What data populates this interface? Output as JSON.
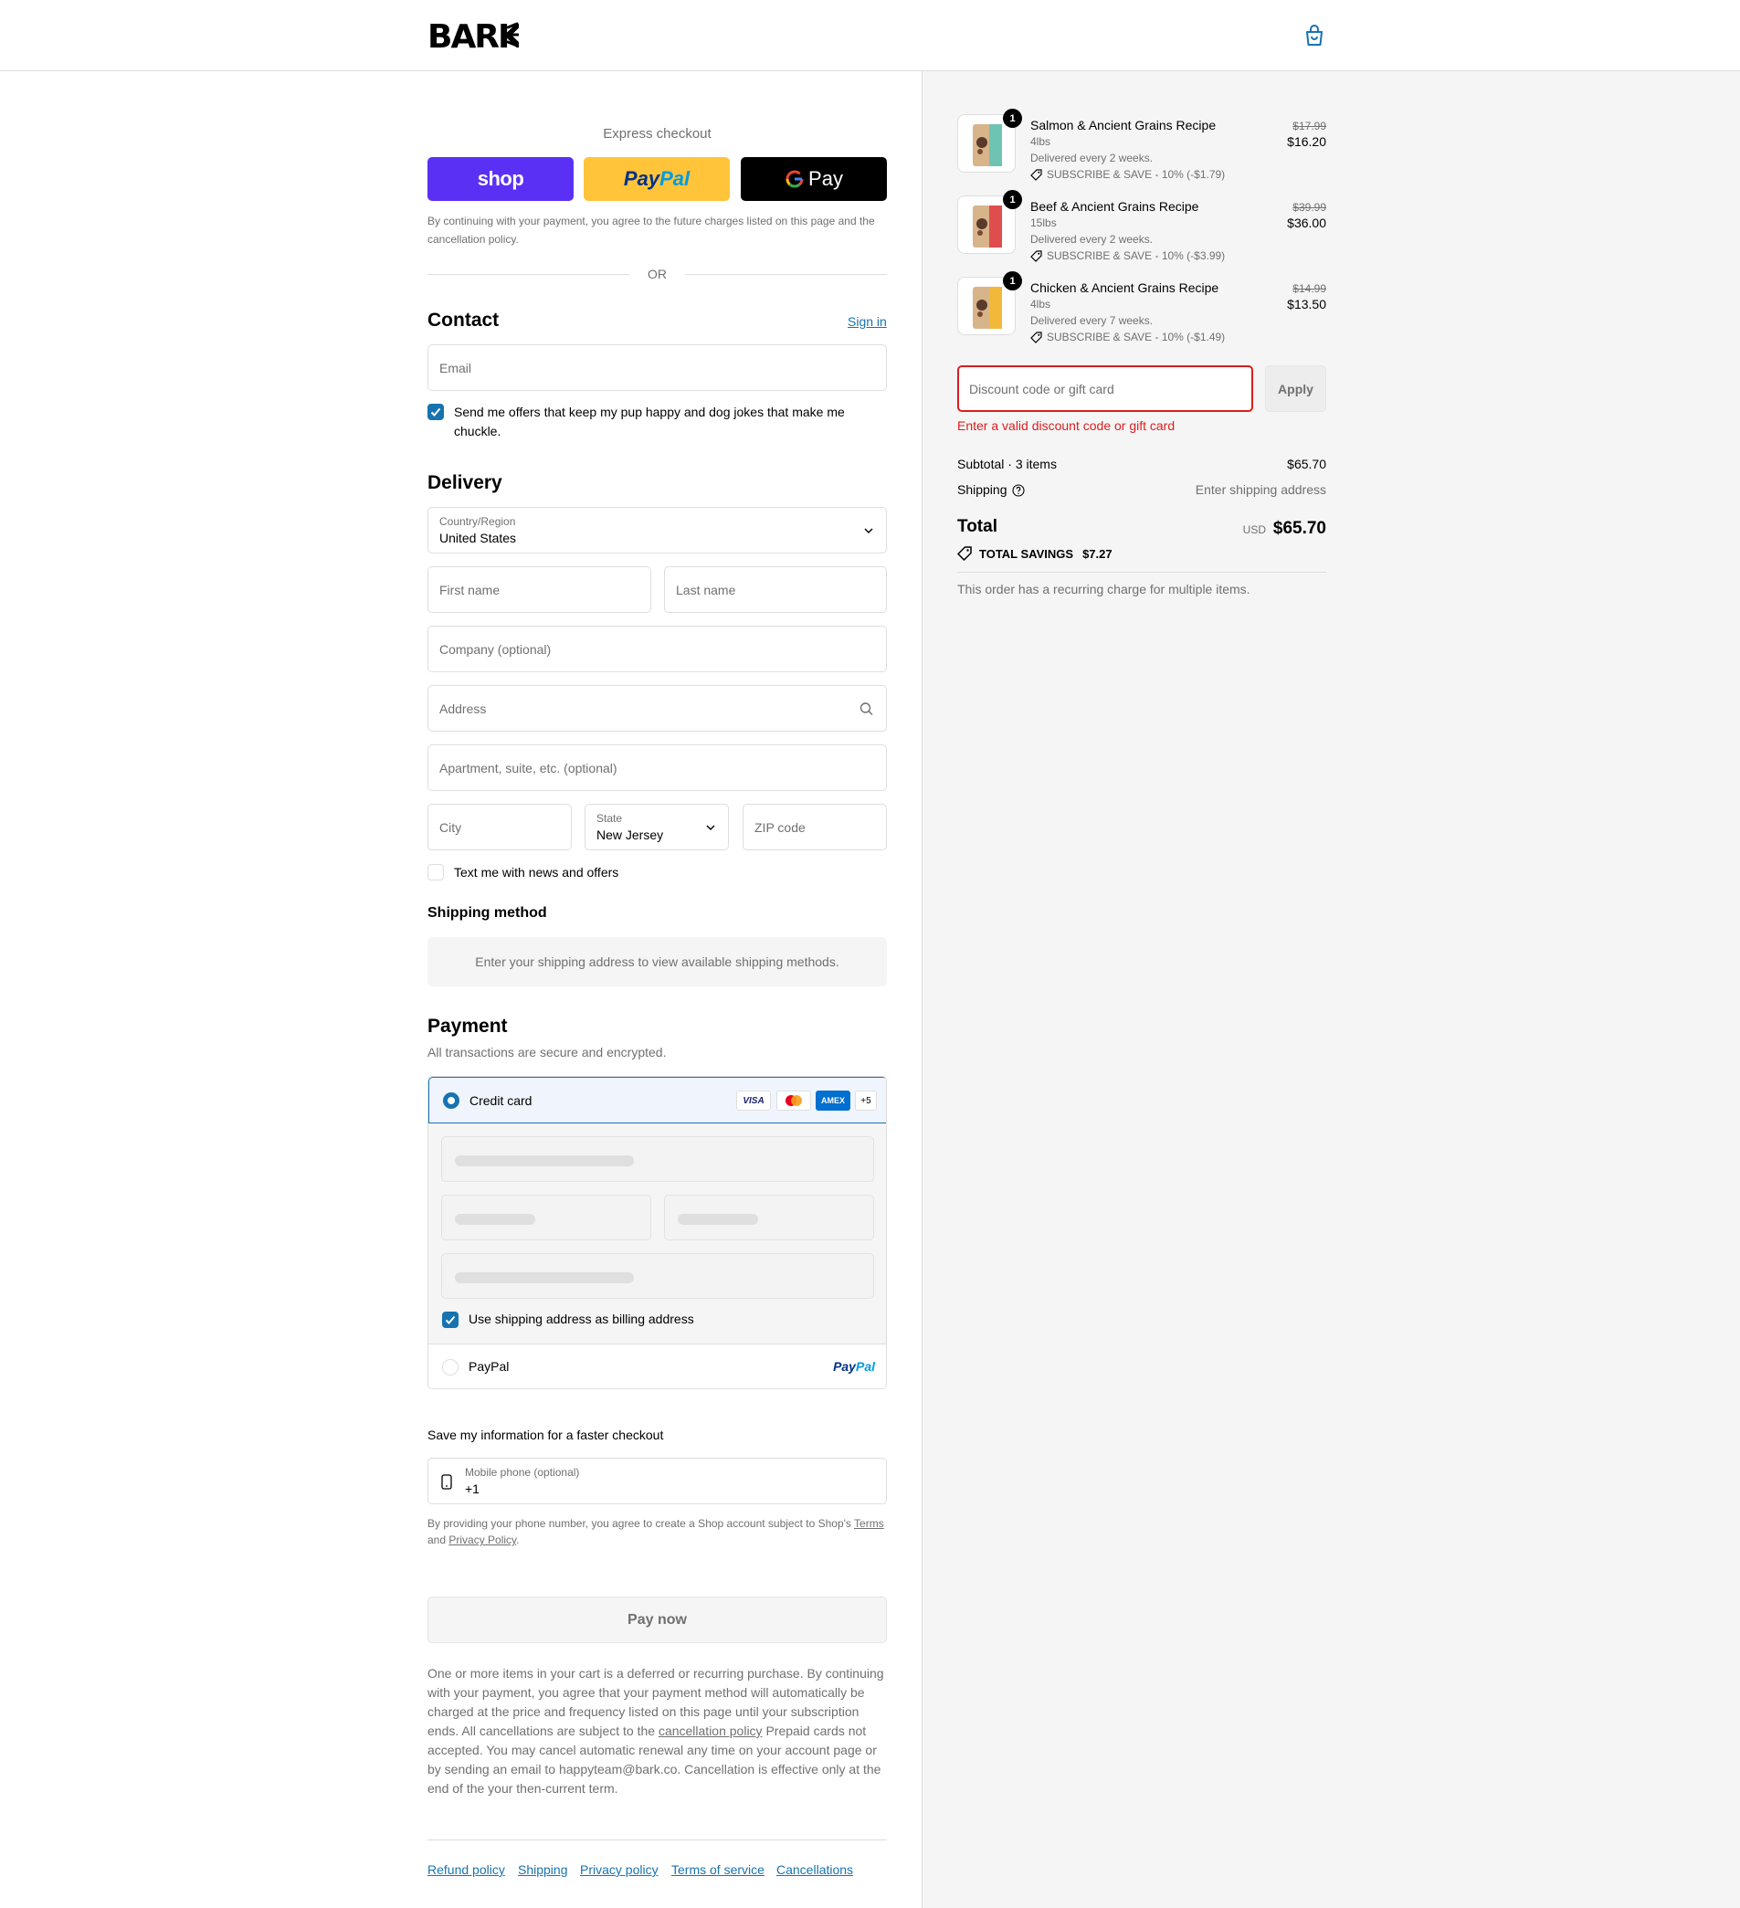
{
  "brand": {
    "logo_text": "BARK",
    "accent": "#1773b0",
    "error": "#dd1d1d"
  },
  "express": {
    "label": "Express checkout",
    "shop_label": "shop",
    "paypal_label_a": "Pay",
    "paypal_label_b": "Pal",
    "gpay_label": "Pay",
    "note": "By continuing with your payment, you agree to the future charges listed on this page and the cancellation policy.",
    "or": "OR"
  },
  "contact": {
    "title": "Contact",
    "sign_in": "Sign in",
    "email_placeholder": "Email",
    "offers_label": "Send me offers that keep my pup happy and dog jokes that make me chuckle.",
    "offers_checked": true
  },
  "delivery": {
    "title": "Delivery",
    "country_label": "Country/Region",
    "country_value": "United States",
    "first_name_placeholder": "First name",
    "last_name_placeholder": "Last name",
    "company_placeholder": "Company (optional)",
    "address_placeholder": "Address",
    "apartment_placeholder": "Apartment, suite, etc. (optional)",
    "city_placeholder": "City",
    "state_label": "State",
    "state_value": "New Jersey",
    "zip_placeholder": "ZIP code",
    "text_me_label": "Text me with news and offers",
    "text_me_checked": false
  },
  "shipping_method": {
    "title": "Shipping method",
    "message": "Enter your shipping address to view available shipping methods."
  },
  "payment": {
    "title": "Payment",
    "subtitle": "All transactions are secure and encrypted.",
    "credit_card_label": "Credit card",
    "card_brands": [
      "VISA",
      "mastercard",
      "AMEX",
      "+5"
    ],
    "billing_label": "Use shipping address as billing address",
    "billing_checked": true,
    "paypal_label": "PayPal",
    "paypal_logo_a": "Pay",
    "paypal_logo_b": "Pal"
  },
  "save_info": {
    "title": "Save my information for a faster checkout",
    "phone_label": "Mobile phone (optional)",
    "phone_value": "+1",
    "note_a": "By providing your phone number, you agree to create a Shop account subject to Shop's ",
    "terms": "Terms",
    "note_b": " and ",
    "privacy": "Privacy Policy",
    "note_c": "."
  },
  "pay_now_label": "Pay now",
  "legal": {
    "text_a": "One or more items in your cart is a deferred or recurring purchase. By continuing with your payment, you agree that your payment method will automatically be charged at the price and frequency listed on this page until your subscription ends. All cancellations are subject to the ",
    "link": "cancellation policy",
    "text_b": " Prepaid cards not accepted. You may cancel automatic renewal any time on your account page or by sending an email to happyteam@bark.co. Cancellation is effective only at the end of the your then-current term."
  },
  "footer_links": [
    "Refund policy",
    "Shipping",
    "Privacy policy",
    "Terms of service",
    "Cancellations"
  ],
  "cart": {
    "items": [
      {
        "qty": "1",
        "name": "Salmon & Ancient Grains Recipe",
        "size": "4lbs",
        "frequency": "Delivered every 2 weeks.",
        "discount": "SUBSCRIBE & SAVE - 10% (-$1.79)",
        "old_price": "$17.99",
        "price": "$16.20",
        "color": "#6fc3b3"
      },
      {
        "qty": "1",
        "name": "Beef & Ancient Grains Recipe",
        "size": "15lbs",
        "frequency": "Delivered every 2 weeks.",
        "discount": "SUBSCRIBE & SAVE - 10% (-$3.99)",
        "old_price": "$39.99",
        "price": "$36.00",
        "color": "#e04d4d"
      },
      {
        "qty": "1",
        "name": "Chicken & Ancient Grains Recipe",
        "size": "4lbs",
        "frequency": "Delivered every 7 weeks.",
        "discount": "SUBSCRIBE & SAVE - 10% (-$1.49)",
        "old_price": "$14.99",
        "price": "$13.50",
        "color": "#f2b83a"
      }
    ],
    "discount_placeholder": "Discount code or gift card",
    "apply_label": "Apply",
    "discount_error": "Enter a valid discount code or gift card",
    "subtotal_label": "Subtotal · 3 items",
    "subtotal_value": "$65.70",
    "shipping_label": "Shipping",
    "shipping_value": "Enter shipping address",
    "total_label": "Total",
    "currency": "USD",
    "total_value": "$65.70",
    "savings_label": "TOTAL SAVINGS",
    "savings_value": "$7.27",
    "recurring_note": "This order has a recurring charge for multiple items."
  }
}
